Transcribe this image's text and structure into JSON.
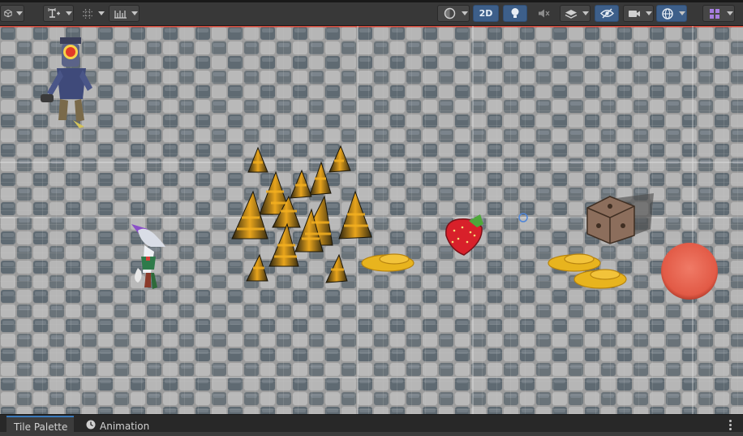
{
  "toolbar": {
    "left_groups": [
      {
        "name": "draw-mode",
        "icon": "cube-icon"
      },
      {
        "name": "move-tool",
        "icon": "move-snap-icon"
      },
      {
        "name": "grid-snapping",
        "icon": "grid-snap-icon"
      },
      {
        "name": "increment-snapping",
        "icon": "ruler-icon"
      }
    ],
    "right_buttons": [
      {
        "name": "shading-mode",
        "icon": "sphere-icon"
      },
      {
        "name": "2d-toggle",
        "label": "2D"
      },
      {
        "name": "lighting-toggle",
        "icon": "lightbulb-icon"
      },
      {
        "name": "audio-toggle",
        "icon": "speaker-muted-icon"
      },
      {
        "name": "effects-toggle",
        "icon": "layers-icon"
      },
      {
        "name": "scene-visibility",
        "icon": "eye-slash-icon"
      },
      {
        "name": "camera-settings",
        "icon": "camera-icon"
      },
      {
        "name": "gizmos-toggle",
        "icon": "globe-icon"
      },
      {
        "name": "layers-dropdown",
        "icon": "grid-icon"
      }
    ]
  },
  "scene": {
    "objects": [
      {
        "name": "robot-character-sprite"
      },
      {
        "name": "fox-character-sprite"
      },
      {
        "name": "spike-cluster-sprite"
      },
      {
        "name": "strawberry-sprite"
      },
      {
        "name": "coin-pile-sprite"
      },
      {
        "name": "wooden-crate-sprite"
      },
      {
        "name": "red-button-sprite"
      }
    ]
  },
  "bottom_tabs": [
    {
      "label": "Tile Palette",
      "icon": "tile-palette-icon"
    },
    {
      "label": "Animation",
      "icon": "clock-icon"
    }
  ],
  "colors": {
    "accent": "#3d5f8a",
    "toolbar_bg": "#383838",
    "scene_tile_dark": "#616a70",
    "scene_tile_light": "#b7b7b7",
    "top_border": "#d84a3a"
  }
}
